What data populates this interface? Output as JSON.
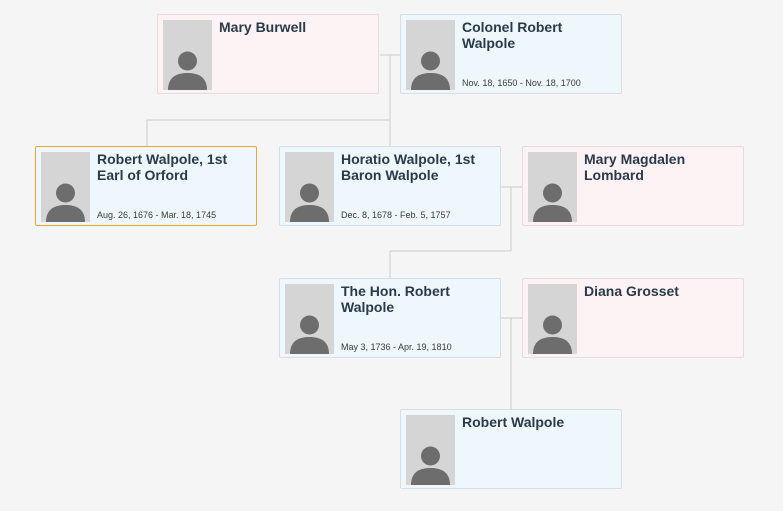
{
  "people": [
    {
      "id": "mary-burwell",
      "name": "Mary Burwell",
      "dates": "",
      "gender": "female"
    },
    {
      "id": "colonel-robert-walpole",
      "name": "Colonel Robert Walpole",
      "dates": "Nov. 18, 1650 - Nov. 18, 1700",
      "gender": "male"
    },
    {
      "id": "robert-walpole-1st-earl",
      "name": "Robert Walpole, 1st Earl of Orford",
      "dates": "Aug. 26, 1676 - Mar. 18, 1745",
      "gender": "male",
      "selected": true
    },
    {
      "id": "horatio-walpole",
      "name": "Horatio Walpole, 1st Baron Walpole",
      "dates": "Dec. 8, 1678 - Feb. 5, 1757",
      "gender": "male"
    },
    {
      "id": "mary-magdalen-lombard",
      "name": "Mary Magdalen Lombard",
      "dates": "",
      "gender": "female"
    },
    {
      "id": "hon-robert-walpole",
      "name": "The Hon. Robert Walpole",
      "dates": "May 3, 1736 - Apr. 19, 1810",
      "gender": "male"
    },
    {
      "id": "diana-grosset",
      "name": "Diana Grosset",
      "dates": "",
      "gender": "female"
    },
    {
      "id": "robert-walpole",
      "name": "Robert Walpole",
      "dates": "",
      "gender": "male"
    }
  ],
  "icons": {
    "avatar": "person-silhouette-icon"
  },
  "colors": {
    "male_card": "#eef8fc",
    "female_card": "#fdf2f4",
    "selected_border": "#e9a83c",
    "connector": "#cccccc",
    "avatar_bg": "#d5d5d5",
    "avatar_figure": "#6d6d6d"
  }
}
